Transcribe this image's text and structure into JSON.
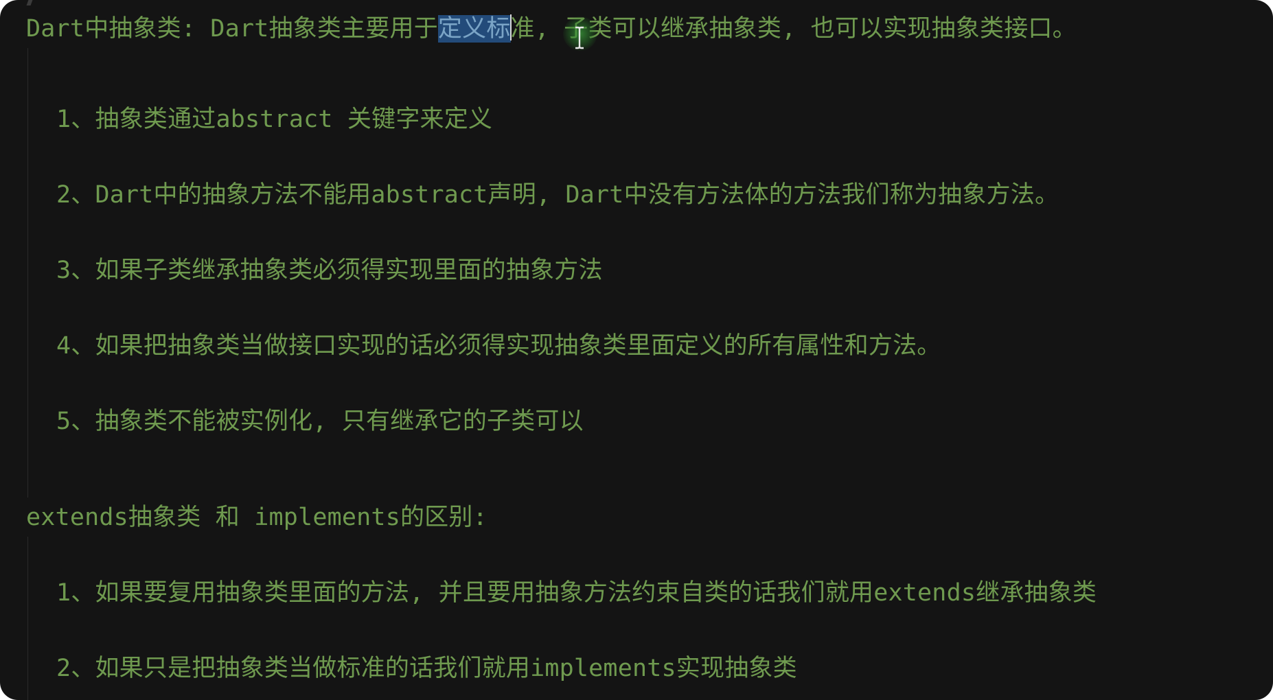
{
  "editor": {
    "heading1": {
      "before": "Dart中抽象类: Dart抽象类主要用于",
      "selected": "定义标",
      "after": "准, 子类可以继承抽象类, 也可以实现抽象类接口。"
    },
    "items1": [
      "1、抽象类通过abstract 关键字来定义",
      "2、Dart中的抽象方法不能用abstract声明, Dart中没有方法体的方法我们称为抽象方法。",
      "3、如果子类继承抽象类必须得实现里面的抽象方法",
      "4、如果把抽象类当做接口实现的话必须得实现抽象类里面定义的所有属性和方法。",
      "5、抽象类不能被实例化, 只有继承它的子类可以"
    ],
    "heading2": "extends抽象类 和 implements的区别:",
    "items2": [
      "1、如果要复用抽象类里面的方法, 并且要用抽象方法约束自类的话我们就用extends继承抽象类",
      "2、如果只是把抽象类当做标准的话我们就用implements实现抽象类"
    ]
  },
  "colors": {
    "background": "#141414",
    "text": "#6f9a4f",
    "selection": "#234b7a"
  },
  "icons": {
    "cursor": "i-beam-cursor-icon"
  }
}
